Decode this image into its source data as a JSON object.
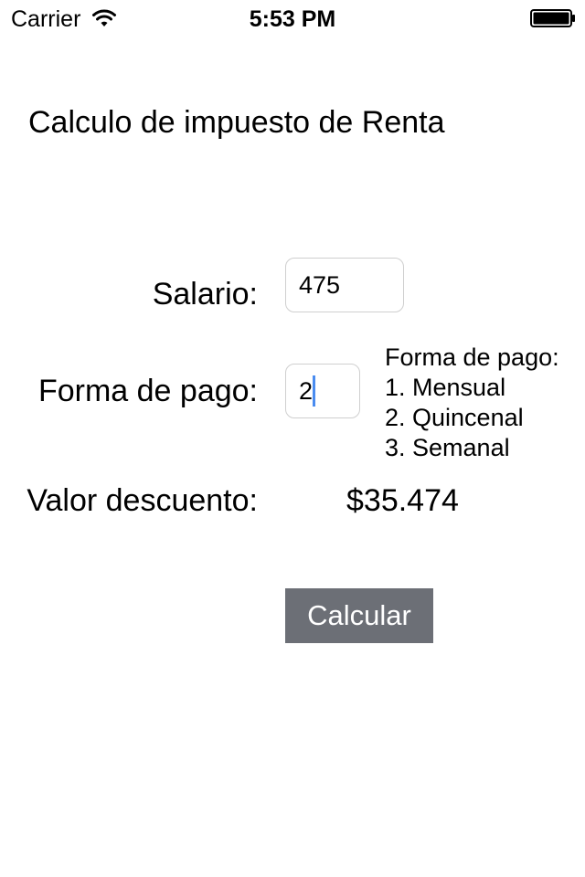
{
  "status_bar": {
    "carrier": "Carrier",
    "time": "5:53 PM",
    "wifi_icon": "wifi-icon",
    "battery_icon": "battery-full-icon"
  },
  "screen": {
    "title": "Calculo de impuesto de Renta"
  },
  "form": {
    "salary_label": "Salario:",
    "salary_value": "475",
    "payment_label": "Forma de pago:",
    "payment_value": "2",
    "discount_label": "Valor descuento:",
    "discount_value": "$35.474"
  },
  "payment_help": {
    "heading": "Forma de pago:",
    "options": [
      "1. Mensual",
      "2. Quincenal",
      "3. Semanal"
    ]
  },
  "actions": {
    "calculate_label": "Calcular"
  },
  "colors": {
    "button_bg": "#6c6f76",
    "button_text": "#ffffff",
    "caret": "#4a8cf0",
    "input_border": "#cfcfcf"
  }
}
